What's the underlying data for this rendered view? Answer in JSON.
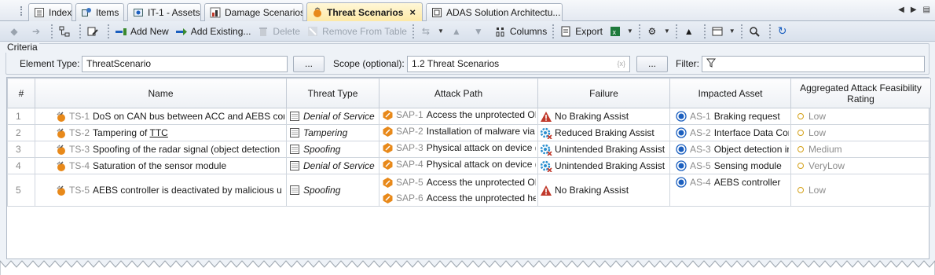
{
  "tabs": [
    {
      "label": "Index",
      "icon": "index-icon"
    },
    {
      "label": "Items",
      "icon": "items-icon"
    },
    {
      "label": "IT-1 - Assets",
      "icon": "assets-icon"
    },
    {
      "label": "Damage Scenarios",
      "icon": "damage-icon"
    },
    {
      "label": "Threat Scenarios",
      "icon": "threat-icon",
      "active": true
    },
    {
      "label": "ADAS Solution Architectu...",
      "icon": "diagram-icon"
    }
  ],
  "toolbar": {
    "add_new": "Add New",
    "add_existing": "Add Existing...",
    "delete": "Delete",
    "remove_from_table": "Remove From Table",
    "columns": "Columns",
    "export": "Export"
  },
  "criteria": {
    "title": "Criteria",
    "element_type_label": "Element Type:",
    "element_type_value": "ThreatScenario",
    "browse": "...",
    "scope_label": "Scope (optional):",
    "scope_value": "1.2 Threat Scenarios",
    "scope_browse": "...",
    "filter_label": "Filter:"
  },
  "table": {
    "headers": [
      "#",
      "Name",
      "Threat Type",
      "Attack Path",
      "Failure",
      "Impacted Asset",
      "Aggregated Attack Feasibility Rating"
    ],
    "rows": [
      {
        "num": "1",
        "name_id": "TS-1",
        "name": "DoS on CAN bus between ACC and AEBS cor",
        "threat": "Denial of Service",
        "paths": [
          {
            "id": "SAP-1",
            "text": "Access the unprotected OB"
          }
        ],
        "failure": "No Braking Assist",
        "failure_icon": "warning",
        "asset_id": "AS-1",
        "asset": "Braking request",
        "rating": "Low"
      },
      {
        "num": "2",
        "name_id": "TS-2",
        "name_pre": "Tampering of ",
        "name_ul": "TTC",
        "threat": "Tampering",
        "paths": [
          {
            "id": "SAP-2",
            "text": "Installation of malware via"
          }
        ],
        "failure": "Reduced Braking Assist",
        "failure_icon": "gear",
        "asset_id": "AS-2",
        "asset": "Interface Data Com",
        "rating": "Low"
      },
      {
        "num": "3",
        "name_id": "TS-3",
        "name": "Spoofing of the radar signal (object detection",
        "threat": "Spoofing",
        "paths": [
          {
            "id": "SAP-3",
            "text": "Physical attack on device (s"
          }
        ],
        "failure": "Unintended Braking Assist",
        "failure_icon": "gear",
        "asset_id": "AS-3",
        "asset": "Object detection in",
        "rating": "Medium"
      },
      {
        "num": "4",
        "name_id": "TS-4",
        "name": "Saturation of the sensor module",
        "threat": "Denial of Service",
        "paths": [
          {
            "id": "SAP-4",
            "text": "Physical attack on device (s"
          }
        ],
        "failure": "Unintended Braking Assist",
        "failure_icon": "gear",
        "asset_id": "AS-5",
        "asset": "Sensing module",
        "rating": "VeryLow"
      },
      {
        "num": "5",
        "name_id": "TS-5",
        "name": "AEBS controller is deactivated by malicious u",
        "threat": "Spoofing",
        "paths": [
          {
            "id": "SAP-5",
            "text": "Access the unprotected OB"
          },
          {
            "id": "SAP-6",
            "text": "Access the unprotected hea"
          }
        ],
        "failure": "No Braking Assist",
        "failure_icon": "warning",
        "asset_id": "AS-4",
        "asset": "AEBS controller",
        "rating": "Low"
      }
    ]
  },
  "colors": {
    "accent_tab": "#fde9a6",
    "rating_ring": "#d4a017",
    "asset_blue": "#1b5fbf",
    "path_orange": "#e8891a"
  }
}
